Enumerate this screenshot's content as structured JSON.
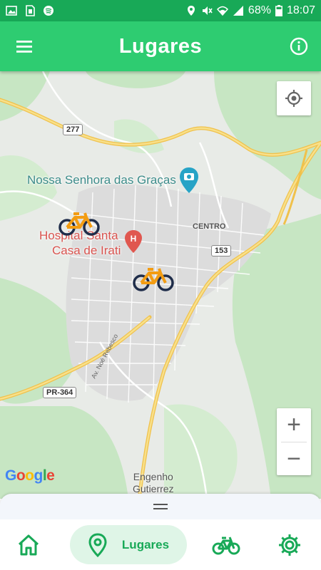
{
  "status_bar": {
    "battery": "68%",
    "time": "18:07",
    "icons_left": [
      "image-icon",
      "sim-icon",
      "spotify-icon"
    ],
    "icons_right": [
      "location-icon",
      "mute-icon",
      "wifi-icon",
      "signal-icon",
      "battery-icon"
    ]
  },
  "app_bar": {
    "title": "Lugares",
    "menu_icon": "menu-icon",
    "info_icon": "info-icon"
  },
  "map": {
    "labels": {
      "neighborhood": "Nossa Senhora das Graças",
      "hospital_line1": "Hospital Santa",
      "hospital_line2": "Casa de Irati",
      "centro": "CENTRO",
      "engenho_line1": "Engenho",
      "engenho_line2": "Gutierrez",
      "street": "Av. Noé Rebesco"
    },
    "shields": {
      "r277": "277",
      "r153": "153",
      "pr364": "PR-364"
    },
    "markers": [
      "bike-marker-1",
      "bike-marker-2"
    ],
    "controls": {
      "zoom_in": "+",
      "zoom_out": "−"
    },
    "attribution": [
      "G",
      "o",
      "o",
      "g",
      "l",
      "e"
    ]
  },
  "bottom_nav": {
    "items": [
      {
        "name": "home",
        "icon": "home-icon"
      },
      {
        "name": "lugares",
        "icon": "location-pin-icon",
        "label": "Lugares",
        "active": true
      },
      {
        "name": "bikes",
        "icon": "bicycle-icon"
      },
      {
        "name": "settings",
        "icon": "gear-icon"
      }
    ]
  },
  "colors": {
    "primary": "#2ecc71",
    "status_bar": "#18a957",
    "active_nav_bg": "#dff5e7",
    "road_major": "#f6cf65",
    "park_green": "#c7e6c3"
  }
}
